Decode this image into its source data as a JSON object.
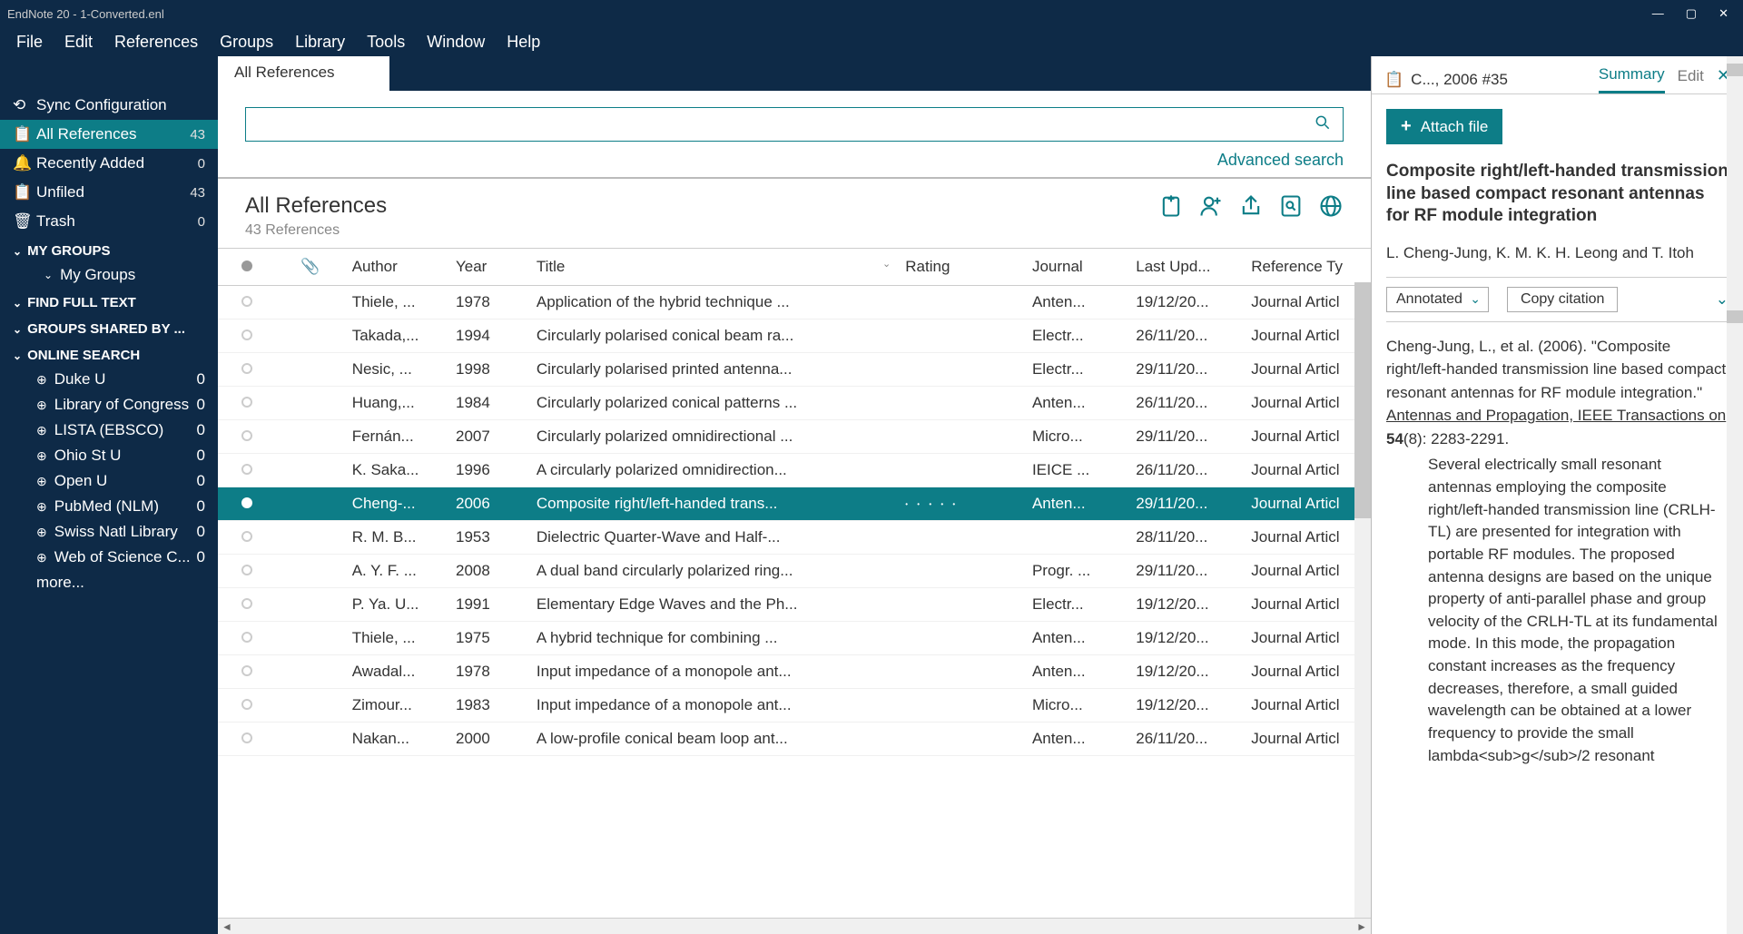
{
  "window": {
    "title": "EndNote 20 - 1-Converted.enl"
  },
  "menu": {
    "items": [
      "File",
      "Edit",
      "References",
      "Groups",
      "Library",
      "Tools",
      "Window",
      "Help"
    ]
  },
  "sidebar": {
    "sync": "Sync Configuration",
    "nav": [
      {
        "icon": "📋",
        "label": "All References",
        "count": "43",
        "active": true
      },
      {
        "icon": "🔔",
        "label": "Recently Added",
        "count": "0"
      },
      {
        "icon": "📋",
        "label": "Unfiled",
        "count": "43"
      },
      {
        "icon": "🗑",
        "label": "Trash",
        "count": "0"
      }
    ],
    "sections": {
      "my_groups": "MY GROUPS",
      "my_groups_sub": "My Groups",
      "find_full_text": "FIND FULL TEXT",
      "groups_shared": "GROUPS SHARED BY ...",
      "online_search": "ONLINE SEARCH"
    },
    "online": [
      {
        "label": "Duke U",
        "count": "0"
      },
      {
        "label": "Library of Congress",
        "count": "0"
      },
      {
        "label": "LISTA (EBSCO)",
        "count": "0"
      },
      {
        "label": "Ohio St U",
        "count": "0"
      },
      {
        "label": "Open U",
        "count": "0"
      },
      {
        "label": "PubMed (NLM)",
        "count": "0"
      },
      {
        "label": "Swiss Natl Library",
        "count": "0"
      },
      {
        "label": "Web of Science C...",
        "count": "0"
      }
    ],
    "more": "more..."
  },
  "tabs": {
    "main": "All References"
  },
  "search": {
    "placeholder": "",
    "advanced": "Advanced search"
  },
  "list": {
    "heading": "All References",
    "sub": "43 References",
    "columns": {
      "author": "Author",
      "year": "Year",
      "title": "Title",
      "rating": "Rating",
      "journal": "Journal",
      "updated": "Last Upd...",
      "reftype": "Reference Ty"
    },
    "rows": [
      {
        "author": "Thiele, ...",
        "year": "1978",
        "title": "Application of the hybrid technique ...",
        "journal": "Anten...",
        "updated": "19/12/20...",
        "reftype": "Journal Articl"
      },
      {
        "author": "Takada,...",
        "year": "1994",
        "title": "Circularly polarised conical beam ra...",
        "journal": "Electr...",
        "updated": "26/11/20...",
        "reftype": "Journal Articl"
      },
      {
        "author": "Nesic, ...",
        "year": "1998",
        "title": "Circularly polarised printed antenna...",
        "journal": "Electr...",
        "updated": "29/11/20...",
        "reftype": "Journal Articl"
      },
      {
        "author": "Huang,...",
        "year": "1984",
        "title": "Circularly polarized conical patterns ...",
        "journal": "Anten...",
        "updated": "26/11/20...",
        "reftype": "Journal Articl"
      },
      {
        "author": "Fernán...",
        "year": "2007",
        "title": "Circularly polarized omnidirectional ...",
        "journal": "Micro...",
        "updated": "29/11/20...",
        "reftype": "Journal Articl"
      },
      {
        "author": "K. Saka...",
        "year": "1996",
        "title": "A circularly polarized omnidirection...",
        "journal": "IEICE ...",
        "updated": "26/11/20...",
        "reftype": "Journal Articl"
      },
      {
        "author": "Cheng-...",
        "year": "2006",
        "title": "Composite right/left-handed trans...",
        "rating": "• • • • •",
        "journal": "Anten...",
        "updated": "29/11/20...",
        "reftype": "Journal Articl",
        "selected": true
      },
      {
        "author": "R. M. B...",
        "year": "1953",
        "title": "Dielectric Quarter-Wave and Half-...",
        "journal": "",
        "updated": "28/11/20...",
        "reftype": "Journal Articl"
      },
      {
        "author": "A. Y. F. ...",
        "year": "2008",
        "title": "A dual band circularly polarized ring...",
        "journal": "Progr. ...",
        "updated": "29/11/20...",
        "reftype": "Journal Articl"
      },
      {
        "author": "P. Ya. U...",
        "year": "1991",
        "title": "Elementary Edge Waves and the Ph...",
        "journal": "Electr...",
        "updated": "19/12/20...",
        "reftype": "Journal Articl"
      },
      {
        "author": "Thiele, ...",
        "year": "1975",
        "title": "A hybrid technique for combining ...",
        "journal": "Anten...",
        "updated": "19/12/20...",
        "reftype": "Journal Articl"
      },
      {
        "author": "Awadal...",
        "year": "1978",
        "title": "Input impedance of a monopole ant...",
        "journal": "Anten...",
        "updated": "19/12/20...",
        "reftype": "Journal Articl"
      },
      {
        "author": "Zimour...",
        "year": "1983",
        "title": "Input impedance of a monopole ant...",
        "journal": "Micro...",
        "updated": "19/12/20...",
        "reftype": "Journal Articl"
      },
      {
        "author": "Nakan...",
        "year": "2000",
        "title": "A low-profile conical beam loop ant...",
        "journal": "Anten...",
        "updated": "26/11/20...",
        "reftype": "Journal Articl"
      }
    ]
  },
  "details": {
    "crumb": "C..., 2006 #35",
    "tab_summary": "Summary",
    "tab_edit": "Edit",
    "attach": "Attach file",
    "title": "Composite right/left-handed transmission line based compact resonant antennas for RF module integration",
    "authors": "L. Cheng-Jung, K. M. K. H. Leong and T. Itoh",
    "style": "Annotated",
    "copy": "Copy citation",
    "citation_prefix": "Cheng-Jung, L., et al. (2006). \"Composite right/left-handed transmission line based compact resonant antennas for RF module integration.\" ",
    "journal_name": "Antennas and Propagation, IEEE Transactions on",
    "citation_suffix_a": " ",
    "citation_vol": "54",
    "citation_suffix_b": "(8): 2283-2291.",
    "abstract": "Several electrically small resonant antennas employing the composite right/left-handed transmission line (CRLH-TL) are presented for integration with portable RF modules. The proposed antenna designs are based on the unique property of anti-parallel phase and group velocity of the CRLH-TL at its fundamental mode. In this mode, the propagation constant increases as the frequency decreases, therefore, a small guided wavelength can be obtained at a lower frequency to provide the small lambda<sub>g</sub>/2 resonant"
  }
}
